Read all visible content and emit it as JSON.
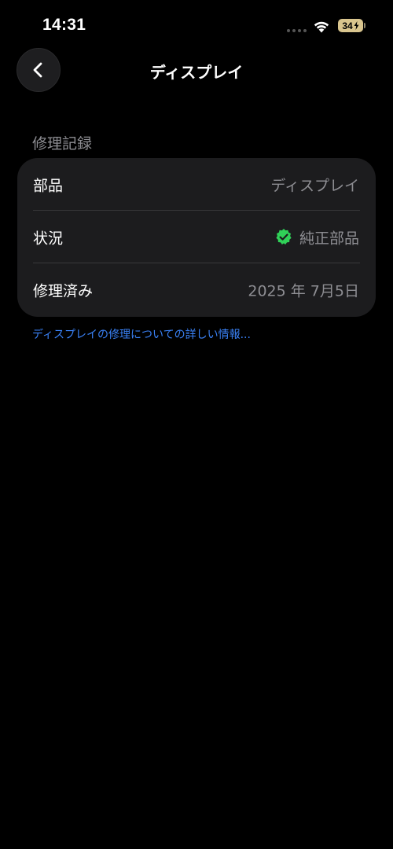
{
  "status_bar": {
    "time": "14:31",
    "battery_level": "34",
    "battery_charging": true,
    "battery_color": "#d9c58e"
  },
  "nav": {
    "back_icon": "chevron-left-icon",
    "title": "ディスプレイ"
  },
  "section": {
    "header": "修理記録",
    "rows": [
      {
        "label": "部品",
        "value": "ディスプレイ"
      },
      {
        "label": "状況",
        "value": "純正部品",
        "icon": "verified-check-icon",
        "icon_color": "#30d158"
      },
      {
        "label": "修理済み",
        "value": "2025 年 7月5日"
      }
    ]
  },
  "footer_link": "ディスプレイの修理についての詳しい情報...",
  "colors": {
    "background": "#000000",
    "card": "#1c1c1e",
    "secondary_text": "#8e8e93",
    "link": "#3a82f7"
  }
}
